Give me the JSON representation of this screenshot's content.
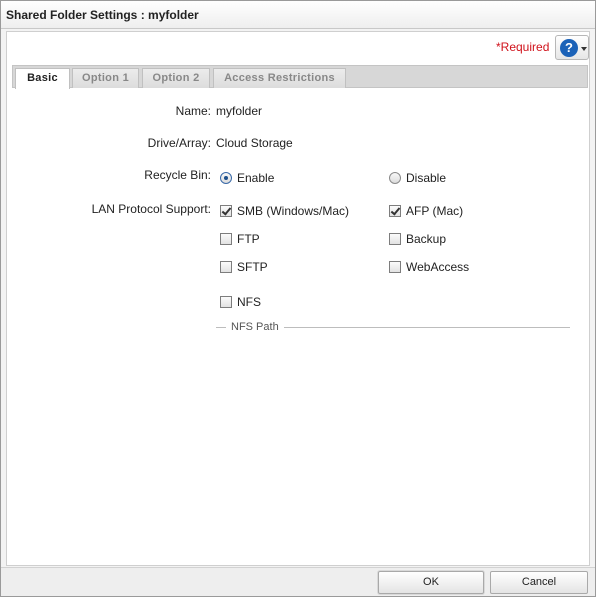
{
  "window": {
    "title": "Shared Folder Settings : myfolder"
  },
  "header": {
    "required_label": "*Required",
    "help_icon_glyph": "?"
  },
  "tabs": [
    "Basic",
    "Option 1",
    "Option 2",
    "Access Restrictions"
  ],
  "active_tab": "Basic",
  "form": {
    "name": {
      "label": "Name:",
      "value": "myfolder"
    },
    "drive": {
      "label": "Drive/Array:",
      "value": "Cloud Storage"
    },
    "recycle_bin": {
      "label": "Recycle Bin:",
      "options": [
        {
          "label": "Enable",
          "selected": true
        },
        {
          "label": "Disable",
          "selected": false
        }
      ]
    },
    "lan_protocol": {
      "label": "LAN Protocol Support:",
      "options": [
        {
          "label": "SMB (Windows/Mac)",
          "checked": true
        },
        {
          "label": "AFP (Mac)",
          "checked": true
        },
        {
          "label": "FTP",
          "checked": false
        },
        {
          "label": "Backup",
          "checked": false
        },
        {
          "label": "SFTP",
          "checked": false
        },
        {
          "label": "WebAccess",
          "checked": false
        },
        {
          "label": "NFS",
          "checked": false
        }
      ]
    },
    "nfs_path_label": "NFS Path"
  },
  "footer": {
    "ok_label": "OK",
    "cancel_label": "Cancel"
  },
  "colors": {
    "accent": "#1b62b8",
    "required": "#d0121b"
  }
}
